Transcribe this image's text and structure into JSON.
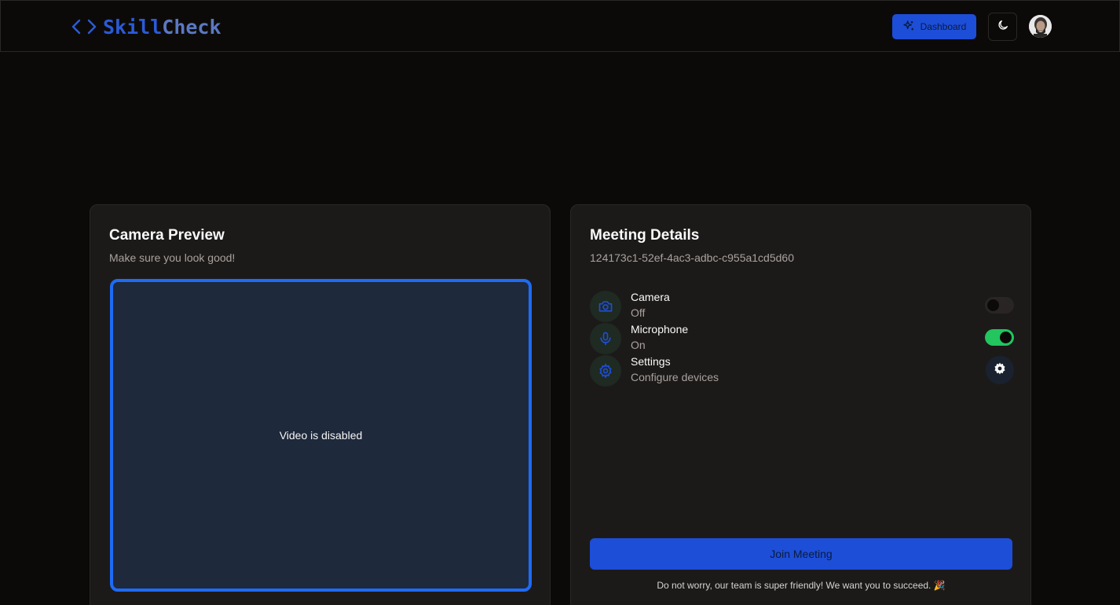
{
  "header": {
    "logo": {
      "part1": "Skill",
      "part2": "Check",
      "icon": "code-brackets-icon"
    },
    "dashboard_label": "Dashboard",
    "dashboard_icon": "sparkles-icon",
    "theme_icon": "moon-icon",
    "avatar_icon": "user-avatar"
  },
  "camera_preview": {
    "title": "Camera Preview",
    "subtitle": "Make sure you look good!",
    "video_message": "Video is disabled"
  },
  "meeting": {
    "title": "Meeting Details",
    "meeting_id": "124173c1-52ef-4ac3-adbc-c955a1cd5d60",
    "devices": [
      {
        "name": "Camera",
        "status": "Off",
        "icon": "camera-icon",
        "enabled": false
      },
      {
        "name": "Microphone",
        "status": "On",
        "icon": "microphone-icon",
        "enabled": true
      },
      {
        "name": "Settings",
        "status": "Configure devices",
        "icon": "settings-icon"
      }
    ],
    "join_label": "Join Meeting",
    "footer_note": "Do not worry, our team is super friendly! We want you to succeed. 🎉"
  },
  "colors": {
    "background": "#0c0a09",
    "card": "#1c1a19",
    "accent": "#1d4ed8",
    "video_border": "#1e6bf5",
    "toggle_on": "#22c55e"
  }
}
